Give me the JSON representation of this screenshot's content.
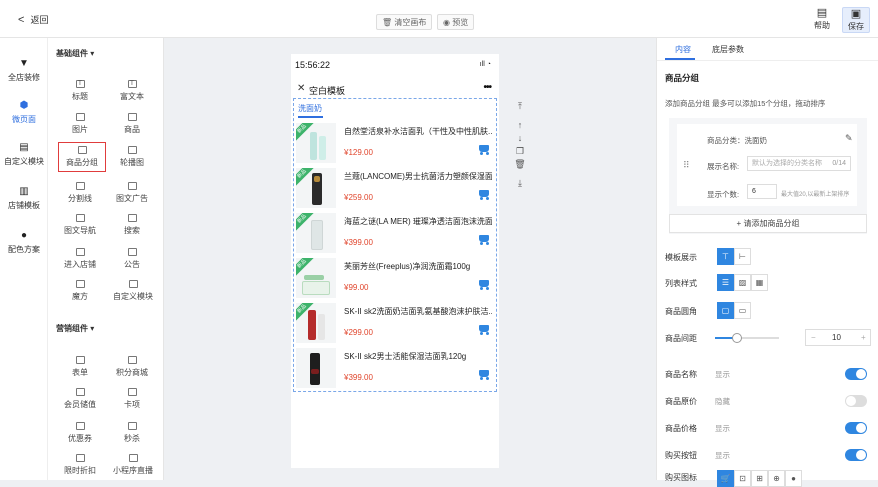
{
  "header": {
    "back_label": "返回",
    "clear_label": "清空画布",
    "preview_label": "预览",
    "help_label": "帮助",
    "save_label": "保存"
  },
  "leftnav": [
    {
      "label": "全店装修",
      "icon": "shirt-icon"
    },
    {
      "label": "微页面",
      "icon": "cube-icon",
      "active": true
    },
    {
      "label": "自定义模块",
      "icon": "doc-icon"
    },
    {
      "label": "店铺模板",
      "icon": "template-icon"
    },
    {
      "label": "配色方案",
      "icon": "palette-icon"
    }
  ],
  "widgets": {
    "basic_group": "基础组件",
    "basic": [
      "标题",
      "富文本",
      "图片",
      "商品",
      "商品分组",
      "轮播图",
      "分割线",
      "图文广告",
      "图文导航",
      "搜索",
      "进入店铺",
      "公告",
      "魔方",
      "自定义模块"
    ],
    "marketing_group": "营销组件",
    "marketing": [
      "表单",
      "积分商城",
      "会员储值",
      "卡项",
      "优惠券",
      "秒杀",
      "限时折扣",
      "小程序直播"
    ]
  },
  "phone": {
    "time": "15:56:22",
    "title": "空白模板",
    "tab": "洗面奶",
    "products": [
      {
        "name": "自然堂活泉补水洁面乳（干性及中性肌肤...",
        "price": "¥129.00",
        "tag": "新品"
      },
      {
        "name": "兰蔻(LANCOME)男士抗菌活力塑颜保湿面...",
        "price": "¥259.00",
        "tag": "新品"
      },
      {
        "name": "海蓝之谜(LA MER) 璀璨净透洁面泡沫洗面...",
        "price": "¥399.00",
        "tag": "新品"
      },
      {
        "name": "芙丽芳丝(Freeplus)净润洗面霜100g",
        "price": "¥99.00",
        "tag": "新品"
      },
      {
        "name": "SK-II sk2洗面奶洁面乳氨基酸泡沫护肤洁...",
        "price": "¥299.00",
        "tag": "新品"
      },
      {
        "name": "SK-II sk2男士活能保湿洁面乳120g",
        "price": "¥399.00",
        "tag": ""
      }
    ]
  },
  "right": {
    "tab_content": "内容",
    "tab_style": "底层参数",
    "section_title": "商品分组",
    "hint": "添加商品分组  最多可以添加15个分组，拖动排序",
    "group_category": "商品分类：洗面奶",
    "display_name_label": "展示名称:",
    "display_name_placeholder": "默认为选择的分类名称",
    "display_name_count": "0/14",
    "display_count_label": "显示个数:",
    "display_count_value": "6",
    "display_count_hint": "最大值20,以最新上架排序",
    "add_group": "+ 请添加商品分组",
    "template_label": "模板展示",
    "list_label": "列表样式",
    "corner_label": "商品圆角",
    "spacing_label": "商品间距",
    "spacing_value": "10",
    "spacing_level": 0.35,
    "name_label": "商品名称",
    "name_state": "显示",
    "orig_label": "商品原价",
    "orig_state": "隐藏",
    "price_label": "商品价格",
    "price_state": "显示",
    "buy_label": "购买按钮",
    "buy_state": "显示",
    "buy_icon_label": "购买图标"
  },
  "colors": {
    "accent": "#2f86e0",
    "price": "#e0452c",
    "tag": "#3db36b"
  }
}
